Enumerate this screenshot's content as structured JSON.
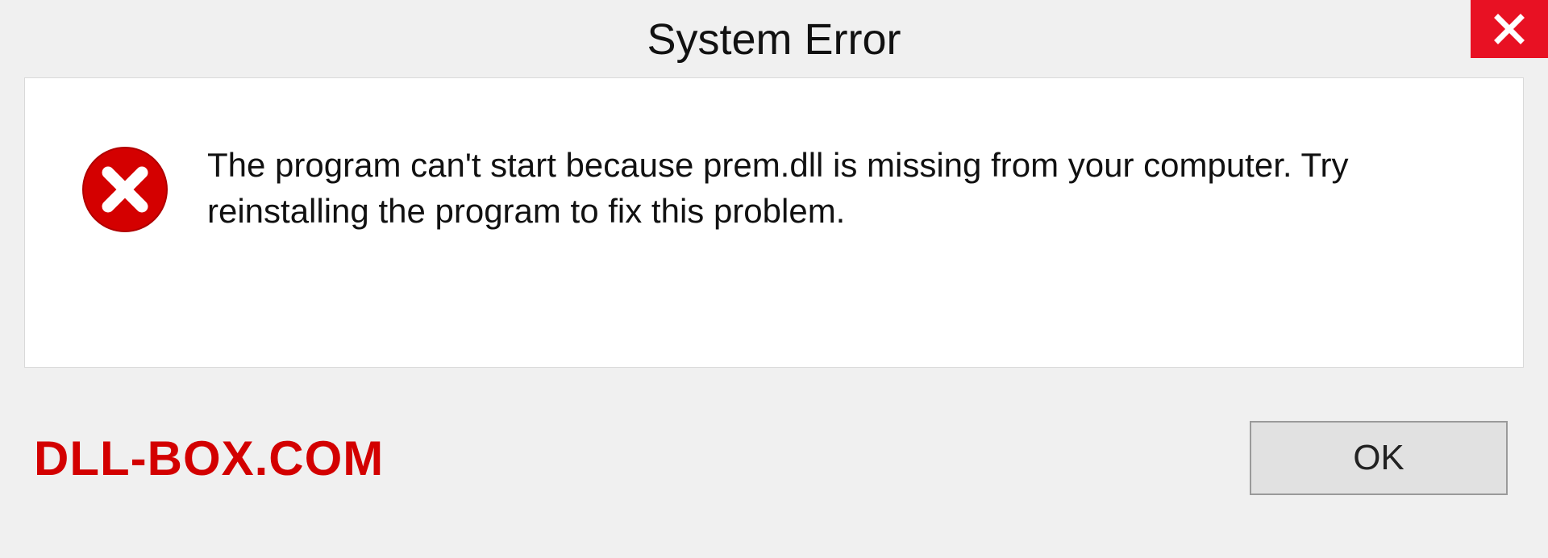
{
  "titlebar": {
    "title": "System Error"
  },
  "dialog": {
    "message": "The program can't start because prem.dll is missing from your computer. Try reinstalling the program to fix this problem."
  },
  "footer": {
    "watermark": "DLL-BOX.COM",
    "ok_label": "OK"
  }
}
